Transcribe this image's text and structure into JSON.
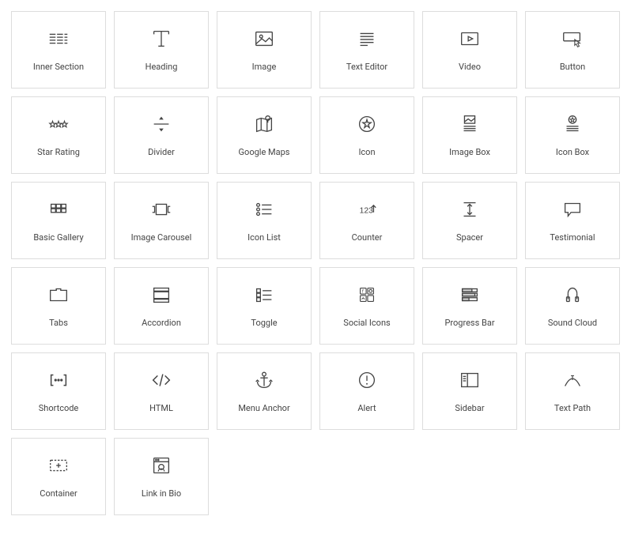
{
  "widgets": [
    {
      "label": "Inner Section",
      "icon": "inner-section"
    },
    {
      "label": "Heading",
      "icon": "heading"
    },
    {
      "label": "Image",
      "icon": "image"
    },
    {
      "label": "Text Editor",
      "icon": "text-editor"
    },
    {
      "label": "Video",
      "icon": "video"
    },
    {
      "label": "Button",
      "icon": "button"
    },
    {
      "label": "Star Rating",
      "icon": "star-rating"
    },
    {
      "label": "Divider",
      "icon": "divider"
    },
    {
      "label": "Google Maps",
      "icon": "google-maps"
    },
    {
      "label": "Icon",
      "icon": "icon"
    },
    {
      "label": "Image Box",
      "icon": "image-box"
    },
    {
      "label": "Icon Box",
      "icon": "icon-box"
    },
    {
      "label": "Basic Gallery",
      "icon": "basic-gallery"
    },
    {
      "label": "Image Carousel",
      "icon": "image-carousel"
    },
    {
      "label": "Icon List",
      "icon": "icon-list"
    },
    {
      "label": "Counter",
      "icon": "counter"
    },
    {
      "label": "Spacer",
      "icon": "spacer"
    },
    {
      "label": "Testimonial",
      "icon": "testimonial"
    },
    {
      "label": "Tabs",
      "icon": "tabs"
    },
    {
      "label": "Accordion",
      "icon": "accordion"
    },
    {
      "label": "Toggle",
      "icon": "toggle"
    },
    {
      "label": "Social Icons",
      "icon": "social-icons"
    },
    {
      "label": "Progress Bar",
      "icon": "progress-bar"
    },
    {
      "label": "Sound Cloud",
      "icon": "sound-cloud"
    },
    {
      "label": "Shortcode",
      "icon": "shortcode"
    },
    {
      "label": "HTML",
      "icon": "html"
    },
    {
      "label": "Menu Anchor",
      "icon": "menu-anchor"
    },
    {
      "label": "Alert",
      "icon": "alert"
    },
    {
      "label": "Sidebar",
      "icon": "sidebar"
    },
    {
      "label": "Text Path",
      "icon": "text-path"
    },
    {
      "label": "Container",
      "icon": "container"
    },
    {
      "label": "Link in Bio",
      "icon": "link-in-bio"
    }
  ]
}
